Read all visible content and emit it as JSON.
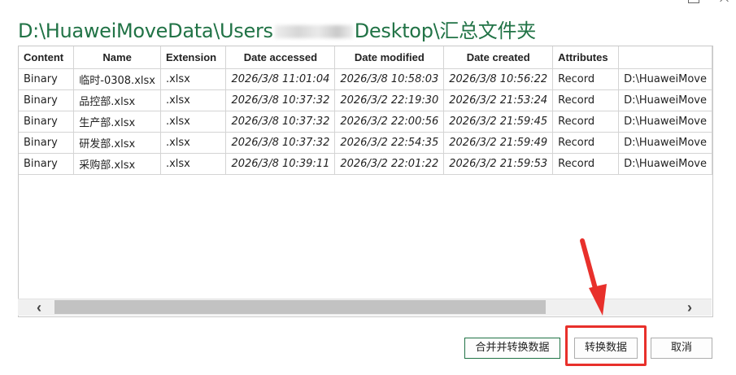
{
  "window": {
    "title_prefix": "D:\\HuaweiMoveData\\Users",
    "title_suffix": "Desktop\\汇总文件夹"
  },
  "table": {
    "columns": [
      "Content",
      "Name",
      "Extension",
      "Date accessed",
      "Date modified",
      "Date created",
      "Attributes",
      ""
    ],
    "rows": [
      [
        "Binary",
        "临时-0308.xlsx",
        ".xlsx",
        "2026/3/8 11:01:04",
        "2026/3/8 10:58:03",
        "2026/3/8 10:56:22",
        "Record",
        "D:\\HuaweiMove"
      ],
      [
        "Binary",
        "品控部.xlsx",
        ".xlsx",
        "2026/3/8 10:37:32",
        "2026/3/2 22:19:30",
        "2026/3/2 21:53:24",
        "Record",
        "D:\\HuaweiMove"
      ],
      [
        "Binary",
        "生产部.xlsx",
        ".xlsx",
        "2026/3/8 10:37:32",
        "2026/3/2 22:00:56",
        "2026/3/2 21:59:45",
        "Record",
        "D:\\HuaweiMove"
      ],
      [
        "Binary",
        "研发部.xlsx",
        ".xlsx",
        "2026/3/8 10:37:32",
        "2026/3/2 22:54:35",
        "2026/3/2 21:59:49",
        "Record",
        "D:\\HuaweiMove"
      ],
      [
        "Binary",
        "采购部.xlsx",
        ".xlsx",
        "2026/3/8 10:39:11",
        "2026/3/2 22:01:22",
        "2026/3/2 21:59:53",
        "Record",
        "D:\\HuaweiMove"
      ]
    ]
  },
  "buttons": {
    "combine_transform": "合并并转换数据",
    "transform": "转换数据",
    "cancel": "取消"
  },
  "scrollbar": {
    "left_icon": "chevron-left",
    "right_icon": "chevron-right"
  },
  "colors": {
    "accent": "#217346",
    "annotation": "#e8302b"
  }
}
